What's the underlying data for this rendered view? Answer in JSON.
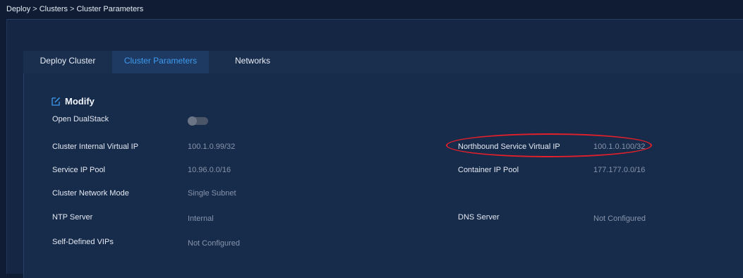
{
  "breadcrumb": {
    "items": [
      "Deploy",
      "Clusters",
      "Cluster Parameters"
    ],
    "separator": ">"
  },
  "tabs": [
    {
      "label": "Deploy Cluster",
      "active": false
    },
    {
      "label": "Cluster Parameters",
      "active": true
    },
    {
      "label": "Networks",
      "active": false
    }
  ],
  "modify": {
    "label": "Modify",
    "icon": "edit-icon"
  },
  "fields": {
    "open_dualstack": {
      "label": "Open DualStack",
      "enabled": false
    },
    "cluster_internal_vip": {
      "label": "Cluster Internal Virtual IP",
      "value": "100.1.0.99/32"
    },
    "northbound_service_vip": {
      "label": "Northbound Service Virtual IP",
      "value": "100.1.0.100/32"
    },
    "service_ip_pool": {
      "label": "Service IP Pool",
      "value": "10.96.0.0/16"
    },
    "container_ip_pool": {
      "label": "Container IP Pool",
      "value": "177.177.0.0/16"
    },
    "cluster_network_mode": {
      "label": "Cluster Network Mode",
      "value": "Single Subnet"
    },
    "ntp_server": {
      "label": "NTP Server",
      "value": "Internal"
    },
    "dns_server": {
      "label": "DNS Server",
      "value": "Not Configured"
    },
    "self_defined_vips": {
      "label": "Self-Defined VIPs",
      "value": "Not Configured"
    }
  },
  "colors": {
    "accent": "#3d9bf0",
    "highlight": "#e0202a"
  }
}
